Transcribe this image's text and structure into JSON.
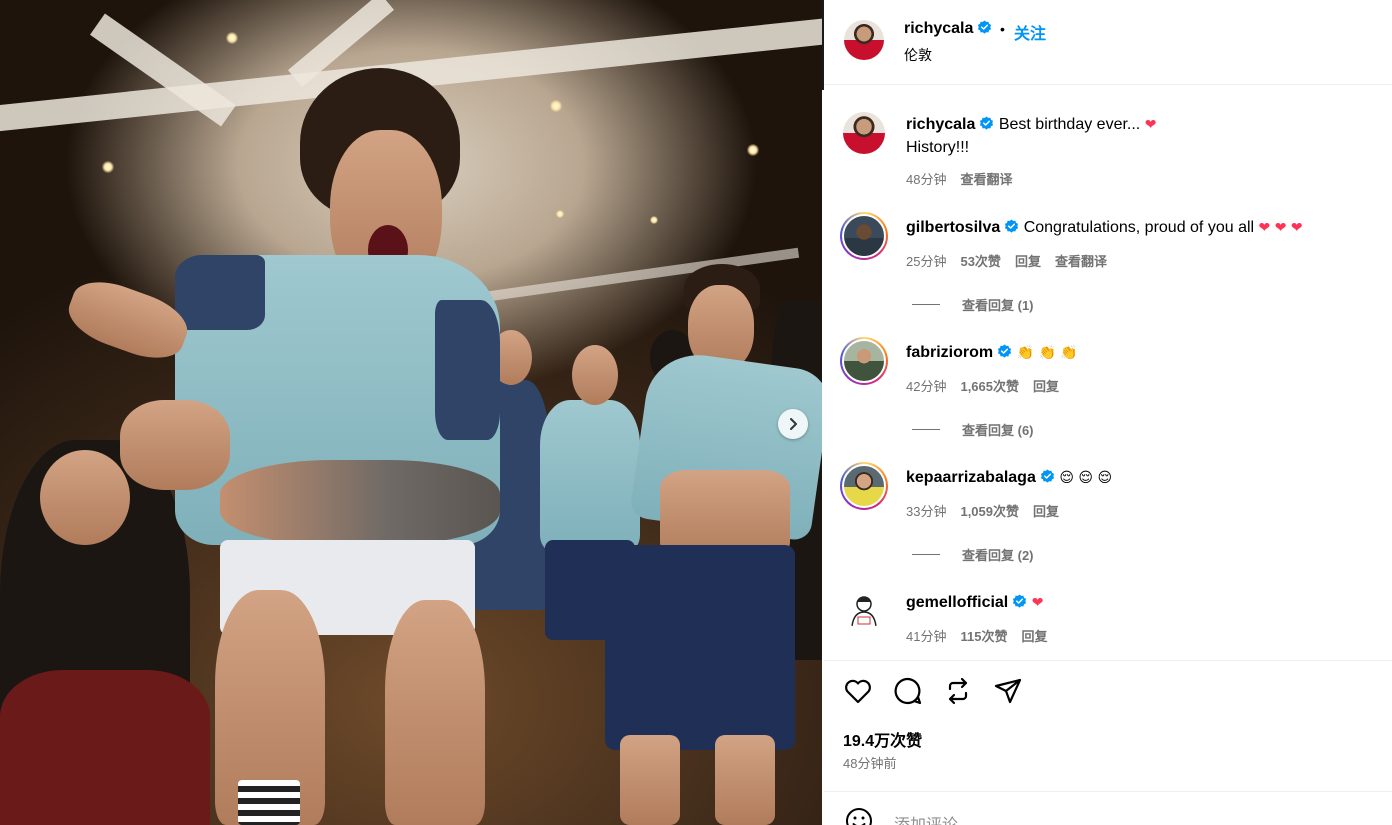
{
  "post": {
    "author": "richycala",
    "follow_label": "关注",
    "separator": "•",
    "location": "伦敦",
    "caption_line1": "Best birthday ever...",
    "caption_line2": "History!!!",
    "caption_time": "48分钟",
    "caption_translate": "查看翻译",
    "likes": "19.4万次赞",
    "posted_ago": "48分钟前",
    "add_comment_placeholder": "添加评论..."
  },
  "comments": [
    {
      "user": "gilbertosilva",
      "text": "Congratulations, proud of you all",
      "emoji": [
        "heart",
        "heart",
        "heart"
      ],
      "time": "25分钟",
      "likes": "53次赞",
      "reply": "回复",
      "translate": "查看翻译",
      "view_replies": "查看回复 (1)"
    },
    {
      "user": "fabriziorom",
      "text": "",
      "emoji": [
        "clap",
        "clap",
        "clap"
      ],
      "time": "42分钟",
      "likes": "1,665次赞",
      "reply": "回复",
      "view_replies": "查看回复 (6)"
    },
    {
      "user": "kepaarrizabalaga",
      "text": "",
      "emoji": [
        "relieved-face",
        "relieved-face",
        "relieved-face"
      ],
      "time": "33分钟",
      "likes": "1,059次赞",
      "reply": "回复",
      "view_replies": "查看回复 (2)"
    },
    {
      "user": "gemellofficial",
      "text": "",
      "emoji": [
        "heart"
      ],
      "time": "41分钟",
      "likes": "115次赞",
      "reply": "回复"
    }
  ],
  "icons": {
    "verified": "verified-badge-icon",
    "like": "heart-icon",
    "comment": "comment-bubble-icon",
    "repost": "repost-icon",
    "share": "send-icon",
    "next": "chevron-right-icon",
    "add_comment": "emoji-icon"
  },
  "colors": {
    "link_blue": "#0095f6",
    "verified_blue": "#0095f6",
    "meta_gray": "#737373",
    "heart_red": "#ff3355"
  }
}
